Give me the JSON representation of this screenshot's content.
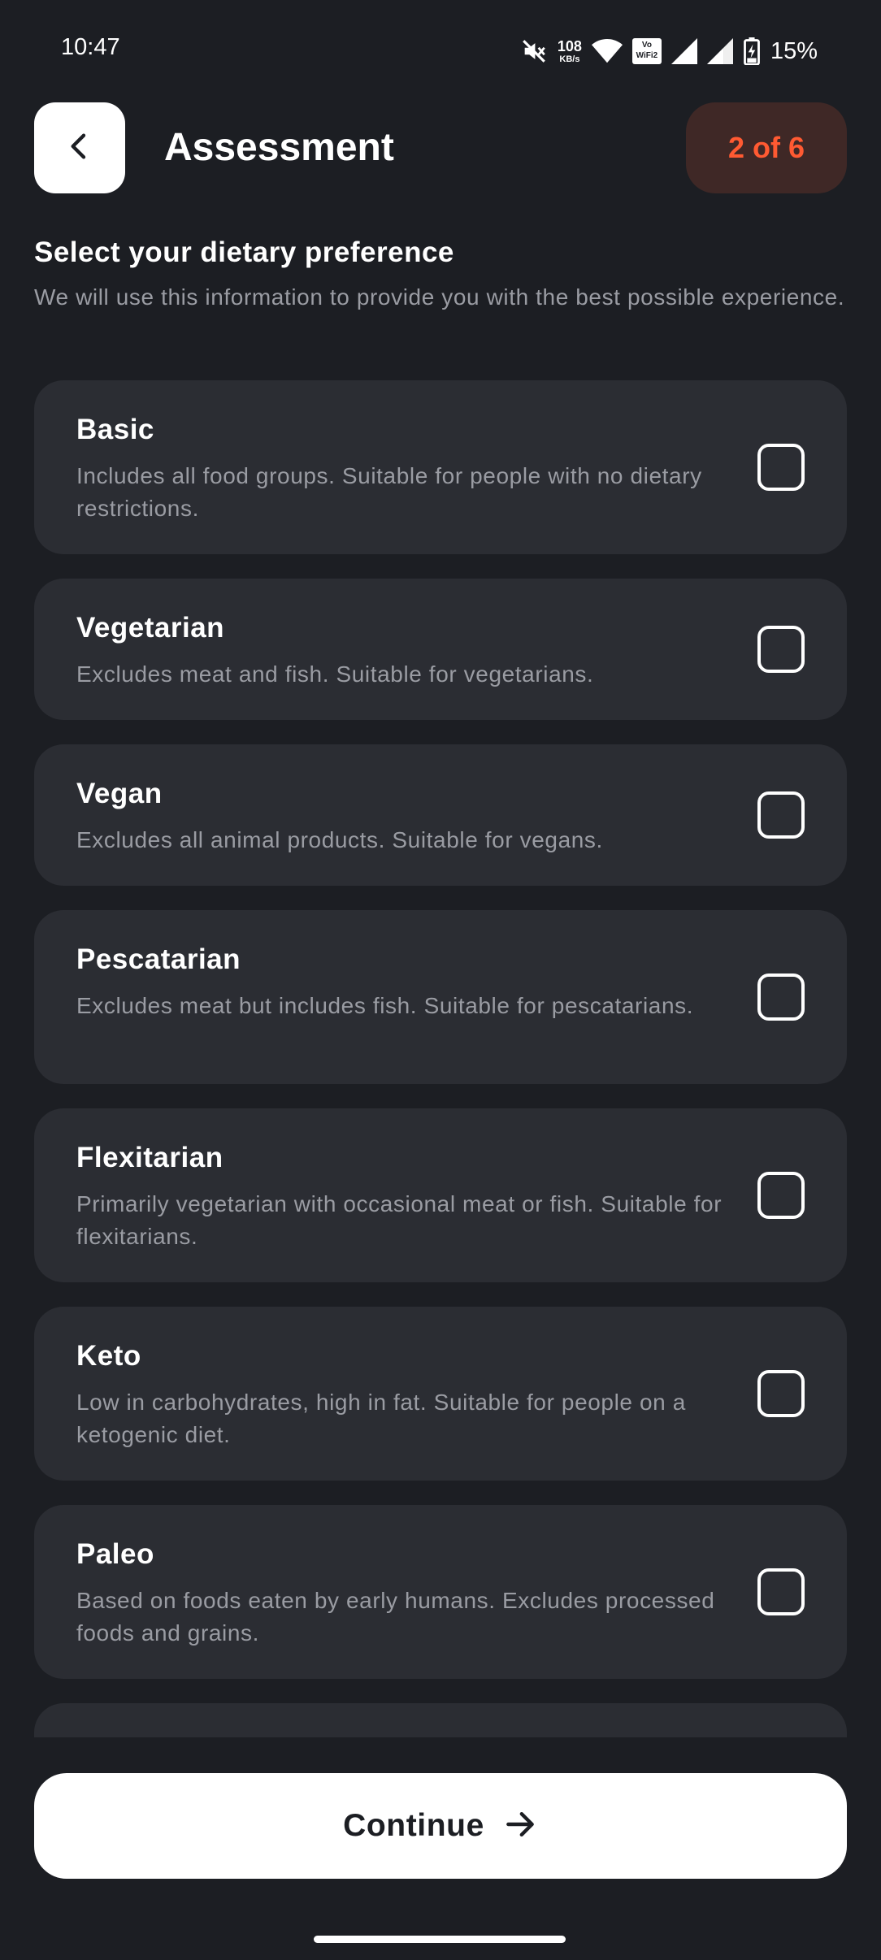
{
  "status_bar": {
    "time": "10:47",
    "net_speed_value": "108",
    "net_speed_unit": "KB/s",
    "volte_line1": "Vo",
    "volte_line2": "WiFi2",
    "battery_percent": "15%",
    "icons": [
      "mute-icon",
      "wifi-icon",
      "vowifi-icon",
      "signal-icon",
      "signal-icon",
      "battery-charging-icon"
    ]
  },
  "header": {
    "back_icon": "chevron-left-icon",
    "title": "Assessment",
    "step": "2 of 6"
  },
  "intro": {
    "heading": "Select your dietary preference",
    "subtext": "We will use this information to provide you with the best possible experience."
  },
  "options": [
    {
      "title": "Basic",
      "description": "Includes all food groups. Suitable for people with no dietary restrictions.",
      "checked": false
    },
    {
      "title": "Vegetarian",
      "description": "Excludes meat and fish. Suitable for vegetarians.",
      "checked": false
    },
    {
      "title": "Vegan",
      "description": "Excludes all animal products. Suitable for vegans.",
      "checked": false
    },
    {
      "title": "Pescatarian",
      "description": "Excludes meat but includes fish. Suitable for pescatarians.",
      "checked": false
    },
    {
      "title": "Flexitarian",
      "description": "Primarily vegetarian with occasional meat or fish. Suitable for flexitarians.",
      "checked": false
    },
    {
      "title": "Keto",
      "description": "Low in carbohydrates, high in fat. Suitable for people on a ketogenic diet.",
      "checked": false
    },
    {
      "title": "Paleo",
      "description": "Based on foods eaten by early humans. Excludes processed foods and grains.",
      "checked": false
    },
    {
      "title": "",
      "description": "",
      "checked": false
    }
  ],
  "footer": {
    "continue_label": "Continue",
    "continue_icon": "arrow-right-icon"
  },
  "colors": {
    "background": "#1c1e23",
    "card": "#2b2d33",
    "accent": "#ff5a32",
    "badge_bg": "#3f2826",
    "muted_text": "#9a9ca3"
  }
}
